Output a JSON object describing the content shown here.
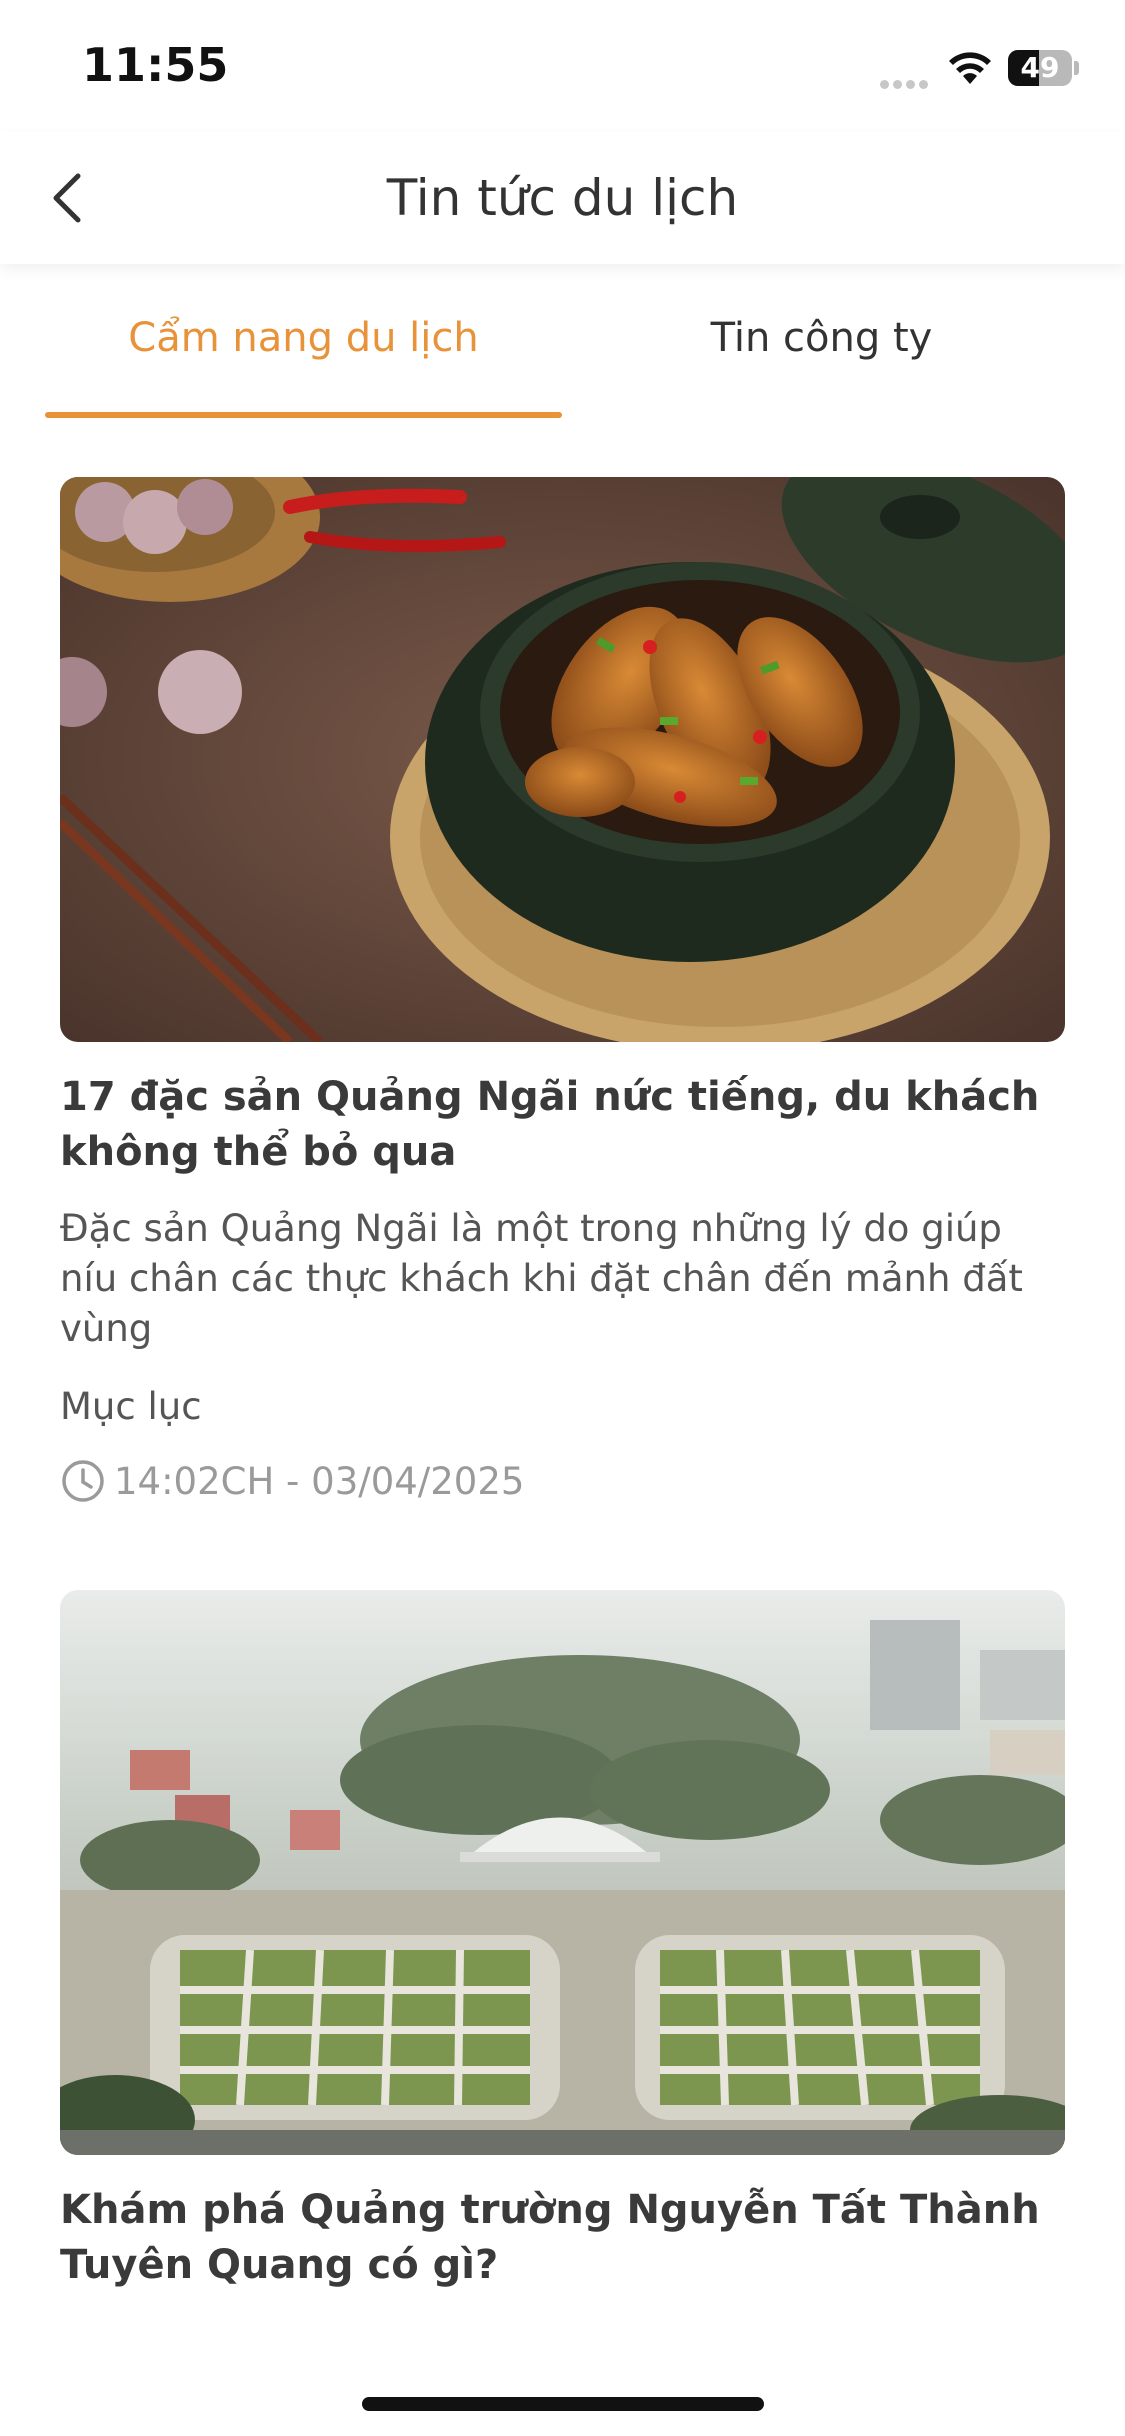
{
  "status_bar": {
    "time": "11:55",
    "battery": "49",
    "battery_level": 0.49
  },
  "header": {
    "title": "Tin tức du lịch",
    "back_icon": "chevron-left-icon"
  },
  "tabs": [
    {
      "label": "Cẩm nang du lịch",
      "active": true
    },
    {
      "label": "Tin công ty",
      "active": false
    }
  ],
  "colors": {
    "accent": "#E8923A",
    "text": "#333333",
    "muted": "#9a9a9a"
  },
  "articles": [
    {
      "title": "17 đặc sản Quảng Ngãi nức tiếng, du khách không thể bỏ qua",
      "summary": "Đặc sản Quảng Ngãi là một trong những lý do giúp níu chân các thực khách khi đặt chân đến mảnh đất vùng",
      "toc": "Mục lục",
      "time": "14:02CH - 03/04/2025"
    },
    {
      "title": "Khám phá Quảng trường Nguyễn Tất Thành Tuyên Quang có gì?"
    }
  ]
}
